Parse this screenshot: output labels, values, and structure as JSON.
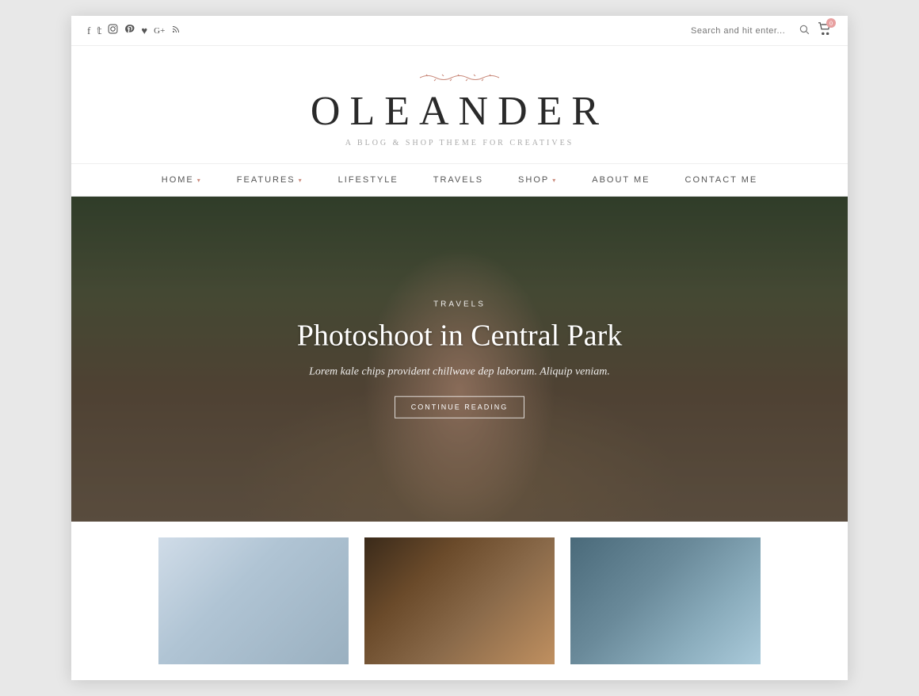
{
  "topbar": {
    "social": [
      {
        "name": "facebook",
        "icon": "f"
      },
      {
        "name": "twitter",
        "icon": "t"
      },
      {
        "name": "instagram",
        "icon": "i"
      },
      {
        "name": "pinterest",
        "icon": "p"
      },
      {
        "name": "heart",
        "icon": "♥"
      },
      {
        "name": "googleplus",
        "icon": "G+"
      },
      {
        "name": "rss",
        "icon": "⌁"
      }
    ],
    "search_placeholder": "Search and hit enter...",
    "cart_count": "0"
  },
  "header": {
    "decoration": "~ ~ ~ ~ ~",
    "title": "OLEANDER",
    "tagline": "A BLOG & SHOP THEME FOR CREATIVES"
  },
  "nav": {
    "items": [
      {
        "label": "HOME",
        "has_arrow": true
      },
      {
        "label": "FEATURES",
        "has_arrow": true
      },
      {
        "label": "LIFESTYLE",
        "has_arrow": false
      },
      {
        "label": "TRAVELS",
        "has_arrow": false
      },
      {
        "label": "SHOP",
        "has_arrow": true
      },
      {
        "label": "ABOUT ME",
        "has_arrow": false
      },
      {
        "label": "CONTACT ME",
        "has_arrow": false
      }
    ]
  },
  "hero": {
    "category": "TRAVELS",
    "title": "Photoshoot in Central Park",
    "excerpt": "Lorem kale chips provident chillwave dep laborum. Aliquip veniam.",
    "cta": "CONTINUE READING"
  },
  "thumbnails": [
    {
      "id": "thumb-1",
      "style": "sky"
    },
    {
      "id": "thumb-2",
      "style": "guitar"
    },
    {
      "id": "thumb-3",
      "style": "mountain"
    }
  ]
}
